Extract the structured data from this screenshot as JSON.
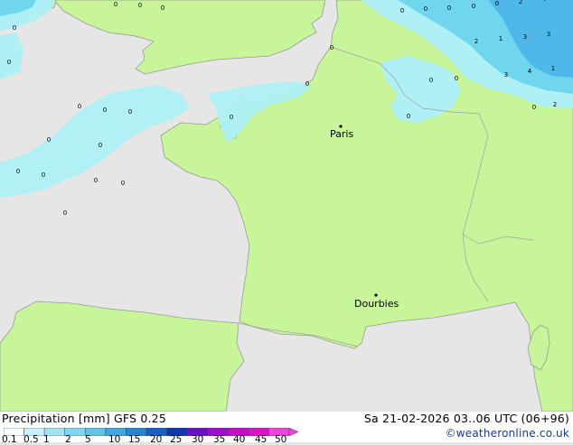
{
  "footer": {
    "title": "Precipitation [mm]  GFS 0.25",
    "datetime": "Sa 21-02-2026 03..06 UTC (06+96)",
    "credit": "©weatheronline.co.uk"
  },
  "colorbar": {
    "labels": [
      "0.1",
      "0.5",
      "1",
      "2",
      "5",
      "10",
      "15",
      "20",
      "25",
      "30",
      "35",
      "40",
      "45",
      "50"
    ],
    "colors": [
      "#f5fbff",
      "#c8f0ff",
      "#9fe4f5",
      "#7fd6f0",
      "#5fc4e8",
      "#3fa6e0",
      "#2a84d4",
      "#1a5cc8",
      "#1036b4",
      "#6a10c8",
      "#a00ad4",
      "#c80ad0",
      "#e010c8",
      "#ee44dc"
    ]
  },
  "map": {
    "colors": {
      "sea": "#e6e6e6",
      "land": "#c8f59a",
      "coast": "#9a9a9a",
      "border": "#a0a0a0",
      "precip_light": "#aef0f5",
      "precip_mid": "#6fd6ee",
      "precip_heavy": "#4fb8e8"
    },
    "cities": [
      {
        "name": "Paris"
      },
      {
        "name": "Dourbies"
      }
    ],
    "precip_values": [
      "0",
      "0",
      "0",
      "0",
      "0",
      "0",
      "0",
      "0",
      "0",
      "0",
      "0",
      "0",
      "0",
      "0",
      "0",
      "0",
      "0",
      "0",
      "0",
      "0",
      "0",
      "0",
      "0",
      "0",
      "0",
      "0",
      "0",
      "2",
      "4",
      "2",
      "1",
      "3",
      "3",
      "3",
      "4",
      "1",
      "2",
      "2",
      "1",
      "2",
      "2",
      "0"
    ]
  }
}
